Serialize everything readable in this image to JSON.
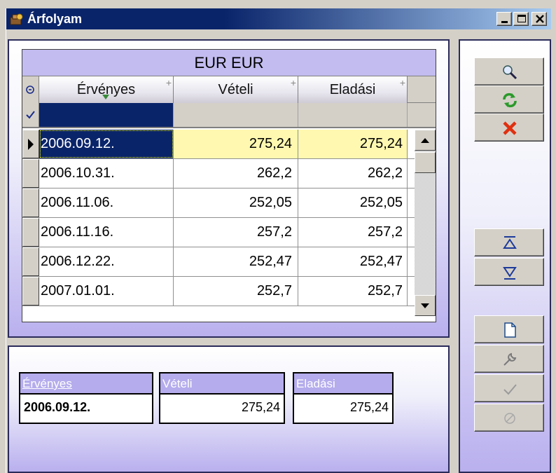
{
  "window": {
    "title": "Árfolyam"
  },
  "grid": {
    "caption": "EUR EUR",
    "columns": [
      "Érvényes",
      "Vételi",
      "Eladási"
    ],
    "rows": [
      {
        "date": "2006.09.12.",
        "veteli": "275,24",
        "eladasi": "275,24",
        "selected": true
      },
      {
        "date": "2006.10.31.",
        "veteli": "262,2",
        "eladasi": "262,2"
      },
      {
        "date": "2006.11.06.",
        "veteli": "252,05",
        "eladasi": "252,05"
      },
      {
        "date": "2006.11.16.",
        "veteli": "257,2",
        "eladasi": "257,2"
      },
      {
        "date": "2006.12.22.",
        "veteli": "252,47",
        "eladasi": "252,47"
      },
      {
        "date": "2007.01.01.",
        "veteli": "252,7",
        "eladasi": "252,7"
      }
    ]
  },
  "detail": {
    "ervenyes_label": "Érvényes",
    "ervenyes_value": "2006.09.12.",
    "veteli_label": "Vételi",
    "veteli_value": "275,24",
    "eladasi_label": "Eladási",
    "eladasi_value": "275,24"
  },
  "toolbar_icons": [
    "search-icon",
    "refresh-icon",
    "delete-icon",
    "first-record-icon",
    "last-record-icon",
    "new-document-icon",
    "edit-wrench-icon",
    "confirm-check-icon",
    "cancel-icon"
  ],
  "colors": {
    "title_bar": "#0a246a",
    "selection": "#0a246a",
    "highlight_cell": "#fff8b0",
    "panel_accent": "#b9b0ee"
  }
}
